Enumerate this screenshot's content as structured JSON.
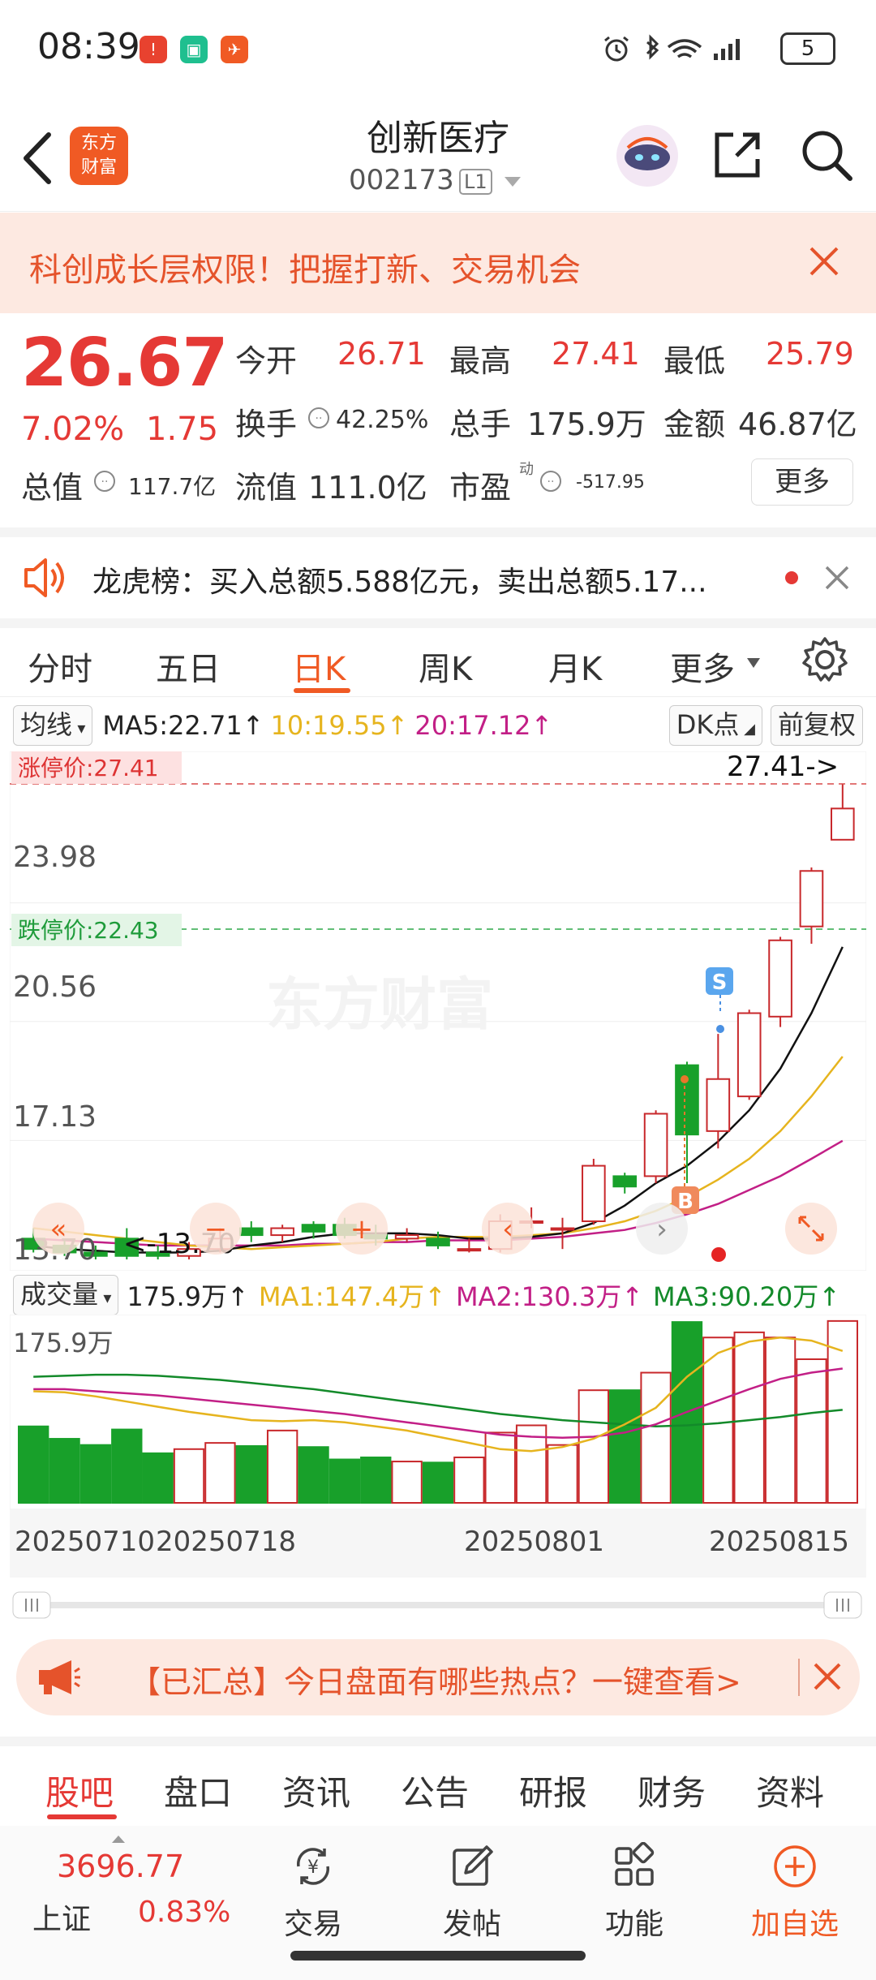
{
  "status_bar": {
    "time": "08:39",
    "battery": "5"
  },
  "header": {
    "stock_name": "创新医疗",
    "stock_code": "002173",
    "level": "L1",
    "logo_text_1": "东方",
    "logo_text_2": "财富"
  },
  "banner": {
    "text": "科创成长层权限！把握打新、交易机会"
  },
  "quote": {
    "price": "26.67",
    "change_pct": "7.02%",
    "change": "1.75",
    "open_label": "今开",
    "open": "26.71",
    "high_label": "最高",
    "high": "27.41",
    "low_label": "最低",
    "low": "25.79",
    "turnover_label": "换手",
    "turnover": "42.25%",
    "volume_label": "总手",
    "volume": "175.9万",
    "amount_label": "金额",
    "amount": "46.87亿",
    "mktcap_label": "总值",
    "mktcap": "117.7亿",
    "float_label": "流值",
    "float_cap": "111.0亿",
    "pe_label": "市盈",
    "pe_sup": "动",
    "pe": "-517.95",
    "more": "更多"
  },
  "dragon": {
    "text": "龙虎榜：买入总额5.588亿元，卖出总额5.17..."
  },
  "tabs": [
    "分时",
    "五日",
    "日K",
    "周K",
    "月K",
    "更多"
  ],
  "active_tab": "日K",
  "ma_row": {
    "selector": "均线",
    "ma5": "MA5:22.71↑",
    "ma10": "10:19.55↑",
    "ma20": "20:17.12↑",
    "dk": "DK点",
    "adjust": "前复权"
  },
  "kchart": {
    "limit_up": "涨停价:27.41",
    "limit_down": "跌停价:22.43",
    "top_price": "27.41->",
    "ticks": [
      "23.98",
      "20.56",
      "17.13",
      "13.70"
    ],
    "low_marker": "<-13.70",
    "watermark": "东方财富",
    "s_mark": "S",
    "b_mark": "B"
  },
  "vol_row": {
    "selector": "成交量",
    "vol": "175.9万↑",
    "ma1": "MA1:147.4万↑",
    "ma2": "MA2:130.3万↑",
    "ma3": "MA3:90.20万↑",
    "max_label": "175.9万"
  },
  "dates": [
    "20250710",
    "20250718",
    "20250801",
    "20250815"
  ],
  "chart_data": {
    "type": "candlestick",
    "candles": [
      {
        "o": 14.3,
        "c": 14.0,
        "h": 14.6,
        "l": 13.9
      },
      {
        "o": 14.1,
        "c": 13.9,
        "h": 14.3,
        "l": 13.8
      },
      {
        "o": 13.9,
        "c": 13.8,
        "h": 14.1,
        "l": 13.7
      },
      {
        "o": 14.3,
        "c": 13.8,
        "h": 14.6,
        "l": 13.7
      },
      {
        "o": 13.9,
        "c": 13.8,
        "h": 14.1,
        "l": 13.7
      },
      {
        "o": 13.8,
        "c": 14.0,
        "h": 14.2,
        "l": 13.7
      },
      {
        "o": 14.0,
        "c": 14.3,
        "h": 14.6,
        "l": 13.9
      },
      {
        "o": 14.6,
        "c": 14.4,
        "h": 14.8,
        "l": 14.2
      },
      {
        "o": 14.4,
        "c": 14.6,
        "h": 14.7,
        "l": 14.2
      },
      {
        "o": 14.7,
        "c": 14.5,
        "h": 14.8,
        "l": 14.3
      },
      {
        "o": 14.7,
        "c": 14.4,
        "h": 14.9,
        "l": 14.3
      },
      {
        "o": 14.4,
        "c": 14.3,
        "h": 14.7,
        "l": 14.1
      },
      {
        "o": 14.3,
        "c": 14.4,
        "h": 14.6,
        "l": 14.2
      },
      {
        "o": 14.3,
        "c": 14.1,
        "h": 14.5,
        "l": 14.0
      },
      {
        "o": 14.0,
        "c": 14.0,
        "h": 14.3,
        "l": 13.9
      },
      {
        "o": 14.0,
        "c": 14.8,
        "h": 15.0,
        "l": 13.9
      },
      {
        "o": 14.8,
        "c": 14.8,
        "h": 15.2,
        "l": 14.6
      },
      {
        "o": 14.6,
        "c": 14.6,
        "h": 14.9,
        "l": 14.0
      },
      {
        "o": 14.8,
        "c": 16.4,
        "h": 16.6,
        "l": 14.7
      },
      {
        "o": 16.1,
        "c": 15.8,
        "h": 16.2,
        "l": 15.6
      },
      {
        "o": 16.1,
        "c": 17.9,
        "h": 18.0,
        "l": 15.9
      },
      {
        "o": 19.3,
        "c": 17.3,
        "h": 19.4,
        "l": 15.9
      },
      {
        "o": 17.4,
        "c": 18.9,
        "h": 20.2,
        "l": 16.9
      },
      {
        "o": 18.4,
        "c": 20.8,
        "h": 20.9,
        "l": 18.3
      },
      {
        "o": 20.7,
        "c": 22.9,
        "h": 23.0,
        "l": 20.4
      },
      {
        "o": 23.3,
        "c": 24.9,
        "h": 25.0,
        "l": 22.8
      },
      {
        "o": 25.8,
        "c": 26.7,
        "h": 27.4,
        "l": 25.8
      }
    ],
    "ma5": [
      14.1,
      14.0,
      13.95,
      13.9,
      13.9,
      13.9,
      13.95,
      14.1,
      14.2,
      14.35,
      14.45,
      14.45,
      14.45,
      14.4,
      14.3,
      14.3,
      14.35,
      14.45,
      14.75,
      15.25,
      15.9,
      16.4,
      17.1,
      18.0,
      19.2,
      20.8,
      22.71
    ],
    "ma10": [
      14.6,
      14.5,
      14.4,
      14.3,
      14.2,
      14.1,
      14.05,
      14.0,
      14.05,
      14.1,
      14.15,
      14.2,
      14.3,
      14.35,
      14.35,
      14.35,
      14.4,
      14.45,
      14.6,
      14.8,
      15.1,
      15.5,
      16.0,
      16.6,
      17.4,
      18.4,
      19.55
    ],
    "ma20": [
      14.3,
      14.25,
      14.2,
      14.15,
      14.1,
      14.1,
      14.1,
      14.1,
      14.1,
      14.15,
      14.15,
      14.2,
      14.2,
      14.25,
      14.25,
      14.25,
      14.3,
      14.35,
      14.45,
      14.55,
      14.75,
      15.0,
      15.3,
      15.7,
      16.1,
      16.6,
      17.12
    ],
    "volume": [
      74,
      62,
      56,
      71,
      48,
      52,
      58,
      55,
      70,
      54,
      42,
      44,
      40,
      39,
      44,
      68,
      75,
      56,
      109,
      109,
      126,
      175,
      160,
      165,
      160,
      139,
      176
    ],
    "vol_ma1": [
      108,
      107,
      103,
      98,
      93,
      88,
      84,
      80,
      79,
      80,
      78,
      74,
      70,
      64,
      58,
      52,
      50,
      54,
      62,
      76,
      92,
      122,
      145,
      156,
      160,
      157,
      147
    ],
    "vol_ma2": [
      110,
      110,
      108,
      106,
      104,
      101,
      98,
      95,
      92,
      89,
      86,
      82,
      78,
      74,
      70,
      66,
      64,
      63,
      64,
      68,
      76,
      88,
      99,
      110,
      120,
      126,
      130
    ],
    "vol_ma3": [
      122,
      123,
      124,
      124,
      123,
      121,
      119,
      116,
      113,
      110,
      106,
      102,
      98,
      94,
      90,
      86,
      83,
      80,
      78,
      76,
      74,
      75,
      77,
      80,
      83,
      87,
      90
    ],
    "ylim": [
      13.7,
      27.41
    ],
    "vol_max": 175.9,
    "colors": {
      "up": "#c8282b",
      "down": "#18a02a",
      "ma5": "#111111",
      "ma10": "#e6b41e",
      "ma20": "#c21f86",
      "vma1": "#e6b41e",
      "vma2": "#c21f86",
      "vma3": "#138a2a"
    }
  },
  "notice": {
    "text": "【已汇总】今日盘面有哪些热点？一键查看>"
  },
  "bottom_tabs": [
    "股吧",
    "盘口",
    "资讯",
    "公告",
    "研报",
    "财务",
    "资料"
  ],
  "nav": {
    "index_value": "3696.77",
    "index_name": "上证",
    "index_pct": "0.83%",
    "items": [
      "交易",
      "发帖",
      "功能",
      "加自选"
    ]
  }
}
